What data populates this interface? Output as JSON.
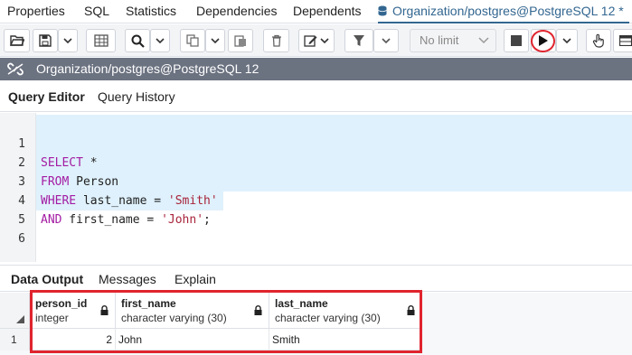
{
  "tabs": [
    {
      "label": "Properties"
    },
    {
      "label": "SQL"
    },
    {
      "label": "Statistics"
    },
    {
      "label": "Dependencies"
    },
    {
      "label": "Dependents"
    },
    {
      "label": "Organization/postgres@PostgreSQL 12 *",
      "active": true
    }
  ],
  "toolbar": {
    "limit_select": "No limit",
    "icons": [
      "open-file-icon",
      "save-icon",
      "dropdown-icon",
      "grid-icon",
      "search-icon",
      "copy-icon",
      "paste-icon",
      "delete-icon",
      "edit-icon",
      "filter-icon",
      "stop-icon",
      "execute-icon",
      "hand-icon",
      "table-icon"
    ]
  },
  "connection": {
    "label": "Organization/postgres@PostgreSQL 12"
  },
  "editor_tabs": [
    {
      "label": "Query Editor",
      "active": true
    },
    {
      "label": "Query History"
    }
  ],
  "editor": {
    "lines": [
      {
        "num": "1",
        "text": "SELECT *"
      },
      {
        "num": "2",
        "text": "FROM Person"
      },
      {
        "num": "3",
        "text": "WHERE last_name = 'Smith'"
      },
      {
        "num": "4",
        "text": "AND first_name = 'John';"
      },
      {
        "num": "5",
        "text": ""
      },
      {
        "num": "6",
        "text": ""
      }
    ]
  },
  "result_tabs": [
    {
      "label": "Data Output",
      "active": true
    },
    {
      "label": "Messages"
    },
    {
      "label": "Explain"
    }
  ],
  "results": {
    "columns": [
      {
        "name": "person_id",
        "type": "integer"
      },
      {
        "name": "first_name",
        "type": "character varying (30)"
      },
      {
        "name": "last_name",
        "type": "character varying (30)"
      }
    ],
    "rows": [
      {
        "row_number": "1",
        "cells": [
          "2",
          "John",
          "Smith"
        ]
      }
    ]
  },
  "colors": {
    "accent": "#326690",
    "highlight_border": "#e0242e",
    "keyword": "#a31ca3",
    "string": "#a8243b",
    "selection": "#dff1fc"
  }
}
